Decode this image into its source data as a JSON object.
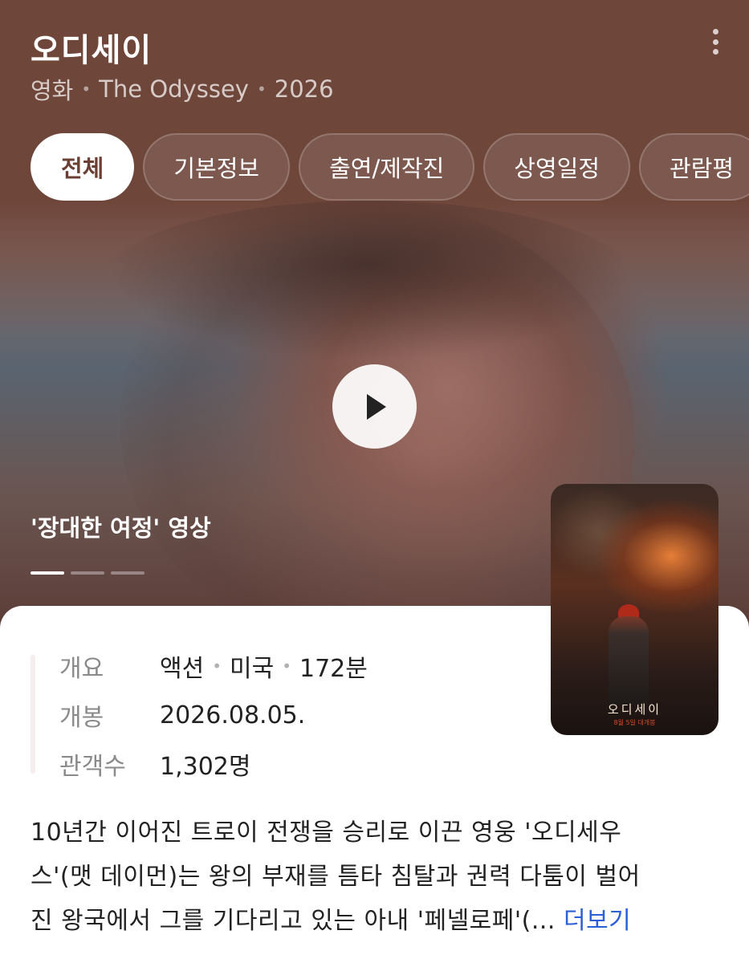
{
  "header": {
    "title": "오디세이",
    "subtitle": {
      "category": "영화",
      "english_title": "The Odyssey",
      "year": "2026"
    }
  },
  "tabs": [
    {
      "label": "전체",
      "active": true
    },
    {
      "label": "기본정보",
      "active": false
    },
    {
      "label": "출연/제작진",
      "active": false
    },
    {
      "label": "상영일정",
      "active": false
    },
    {
      "label": "관람평",
      "active": false
    }
  ],
  "video": {
    "caption": "'장대한 여정' 영상",
    "slides": 3,
    "active_slide": 1
  },
  "poster": {
    "title": "오디세이",
    "date_text": "8월 5일 대개봉"
  },
  "info": {
    "overview_label": "개요",
    "genre": "액션",
    "country": "미국",
    "runtime": "172분",
    "release_label": "개봉",
    "release_date": "2026.08.05.",
    "audience_label": "관객수",
    "audience": "1,302명"
  },
  "synopsis": {
    "line1": "10년간 이어진 트로이 전쟁을 승리로 이끈 영웅 '오디세우",
    "line2": "스'(맷 데이먼)는 왕의 부재를 틈타 침탈과 권력 다툼이 벌어",
    "line3": "진 왕국에서 그를 기다리고 있는 아내 '페넬로페'(...",
    "more_label": "더보기"
  },
  "colors": {
    "header_bg": "#6f463a",
    "active_tab_text": "#6b3f33",
    "link": "#2b5fd9"
  }
}
